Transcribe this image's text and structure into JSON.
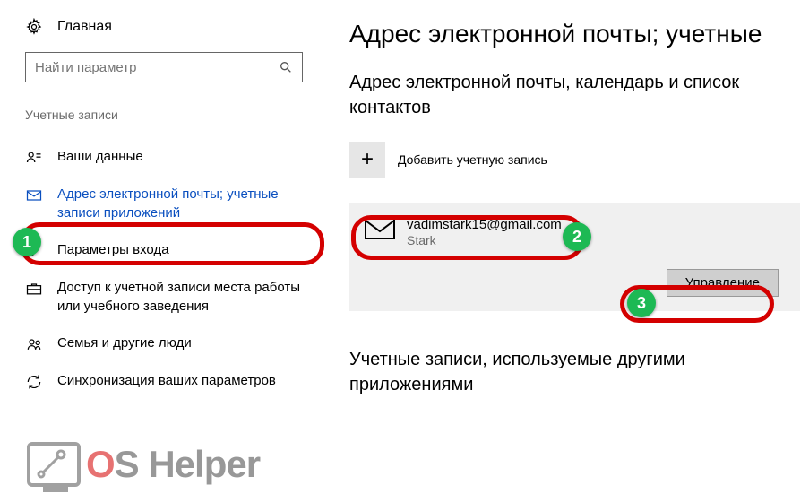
{
  "sidebar": {
    "home_label": "Главная",
    "search_placeholder": "Найти параметр",
    "section_label": "Учетные записи",
    "items": [
      {
        "label": "Ваши данные"
      },
      {
        "label": "Адрес электронной почты; учетные записи приложений"
      },
      {
        "label": "Параметры входа"
      },
      {
        "label": "Доступ к учетной записи места работы или учебного заведения"
      },
      {
        "label": "Семья и другие люди"
      },
      {
        "label": "Синхронизация ваших параметров"
      }
    ]
  },
  "main": {
    "title": "Адрес электронной почты; учетные",
    "subtitle": "Адрес электронной почты, календарь и список контактов",
    "add_account_label": "Добавить учетную запись",
    "account": {
      "email": "vadimstark15@gmail.com",
      "name": "Stark",
      "manage_label": "Управление"
    },
    "section2": "Учетные записи, используемые другими приложениями"
  },
  "annotations": {
    "badge1": "1",
    "badge2": "2",
    "badge3": "3"
  },
  "watermark": {
    "o": "O",
    "s": "S ",
    "rest": "Helper"
  }
}
